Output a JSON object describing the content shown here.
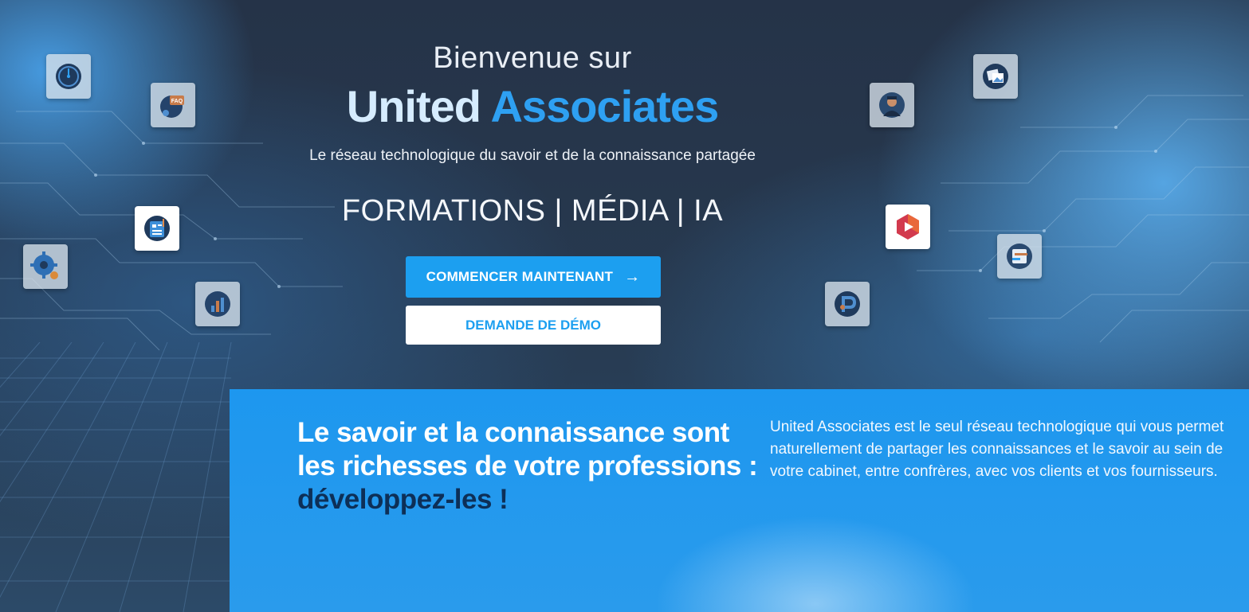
{
  "hero": {
    "welcome": "Bienvenue sur",
    "brand_part1": "United",
    "brand_part2": "Associates",
    "tagline": "Le réseau technologique du savoir et de la connaissance partagée",
    "pillars": "FORMATIONS | MÉDIA | IA",
    "primary_button": "COMMENCER MAINTENANT",
    "primary_button_icon": "arrow-right-icon",
    "secondary_button": "DEMANDE DE DÉMO"
  },
  "floating_icons": [
    "speedometer-icon",
    "faq-icon",
    "document-list-icon",
    "gear-icon",
    "chart-presentation-icon",
    "worker-avatar-icon",
    "images-gallery-icon",
    "video-play-icon",
    "form-editor-icon",
    "podcast-p-icon"
  ],
  "band": {
    "heading_line1": "Le savoir et la connaissance sont",
    "heading_line2": "les richesses de votre professions :",
    "heading_line3": "développez-les !",
    "description": "United Associates est le seul réseau technologique qui vous permet naturellement de partager les connaissances et le savoir au sein de votre cabinet, entre confrères, avec vos clients et vos fournisseurs."
  },
  "colors": {
    "accent": "#1c9ff0",
    "brand_light": "#d6ecff",
    "heading_dark": "#0d2f57"
  }
}
